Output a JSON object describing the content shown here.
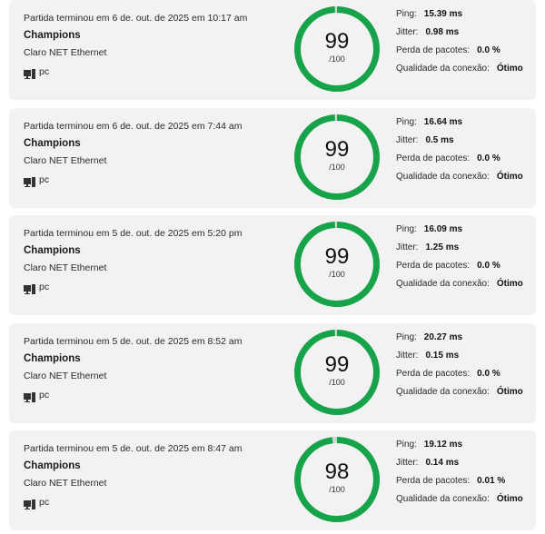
{
  "colors": {
    "ring": "#16a34a",
    "ring_track": "#cfd8d3"
  },
  "matches": [
    {
      "ended": "Partida terminou em 6 de. out. de 2025 em 10:17 am",
      "mode": "Champions",
      "network": "Claro NET Ethernet",
      "device_icon": "computer-icon",
      "device": "pc",
      "score": "99",
      "score_value": 99,
      "out_of": "/100",
      "ping_label": "Ping:",
      "ping": "15.39 ms",
      "jitter_label": "Jitter:",
      "jitter": "0.98 ms",
      "loss_label": "Perda de pacotes:",
      "loss": "0.0 %",
      "quality_label": "Qualidade da conexão:",
      "quality": "Ótimo"
    },
    {
      "ended": "Partida terminou em 6 de. out. de 2025 em 7:44 am",
      "mode": "Champions",
      "network": "Claro NET Ethernet",
      "device_icon": "computer-icon",
      "device": "pc",
      "score": "99",
      "score_value": 99,
      "out_of": "/100",
      "ping_label": "Ping:",
      "ping": "16.64 ms",
      "jitter_label": "Jitter:",
      "jitter": "0.5 ms",
      "loss_label": "Perda de pacotes:",
      "loss": "0.0 %",
      "quality_label": "Qualidade da conexão:",
      "quality": "Ótimo"
    },
    {
      "ended": "Partida terminou em 5 de. out. de 2025 em 5:20 pm",
      "mode": "Champions",
      "network": "Claro NET Ethernet",
      "device_icon": "computer-icon",
      "device": "pc",
      "score": "99",
      "score_value": 99,
      "out_of": "/100",
      "ping_label": "Ping:",
      "ping": "16.09 ms",
      "jitter_label": "Jitter:",
      "jitter": "1.25 ms",
      "loss_label": "Perda de pacotes:",
      "loss": "0.0 %",
      "quality_label": "Qualidade da conexão:",
      "quality": "Ótimo"
    },
    {
      "ended": "Partida terminou em 5 de. out. de 2025 em 8:52 am",
      "mode": "Champions",
      "network": "Claro NET Ethernet",
      "device_icon": "computer-icon",
      "device": "pc",
      "score": "99",
      "score_value": 99,
      "out_of": "/100",
      "ping_label": "Ping:",
      "ping": "20.27 ms",
      "jitter_label": "Jitter:",
      "jitter": "0.15 ms",
      "loss_label": "Perda de pacotes:",
      "loss": "0.0 %",
      "quality_label": "Qualidade da conexão:",
      "quality": "Ótimo"
    },
    {
      "ended": "Partida terminou em 5 de. out. de 2025 em 8:47 am",
      "mode": "Champions",
      "network": "Claro NET Ethernet",
      "device_icon": "computer-icon",
      "device": "pc",
      "score": "98",
      "score_value": 98,
      "out_of": "/100",
      "ping_label": "Ping:",
      "ping": "19.12 ms",
      "jitter_label": "Jitter:",
      "jitter": "0.14 ms",
      "loss_label": "Perda de pacotes:",
      "loss": "0.01 %",
      "quality_label": "Qualidade da conexão:",
      "quality": "Ótimo"
    }
  ]
}
